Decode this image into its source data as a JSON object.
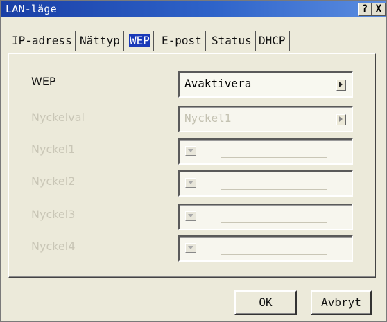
{
  "window": {
    "title": "LAN-läge",
    "help_label": "?",
    "close_label": "X"
  },
  "tabs": [
    {
      "label": "IP-adress",
      "active": false
    },
    {
      "label": "Nättyp",
      "active": false
    },
    {
      "label": "WEP",
      "active": true
    },
    {
      "label": "E-post",
      "active": false
    },
    {
      "label": "Status",
      "active": false
    },
    {
      "label": "DHCP",
      "active": false
    }
  ],
  "rows": {
    "wep": {
      "label": "WEP",
      "value": "Avaktivera",
      "enabled": true
    },
    "key_select": {
      "label": "Nyckelval",
      "value": "Nyckel1",
      "enabled": false
    },
    "key1": {
      "label": "Nyckel1",
      "value": "",
      "enabled": false
    },
    "key2": {
      "label": "Nyckel2",
      "value": "",
      "enabled": false
    },
    "key3": {
      "label": "Nyckel3",
      "value": "",
      "enabled": false
    },
    "key4": {
      "label": "Nyckel4",
      "value": "",
      "enabled": false
    }
  },
  "buttons": {
    "ok": "OK",
    "cancel": "Avbryt"
  },
  "icons": {
    "right_arrow": "right-arrow-icon",
    "dropdown": "dropdown-icon"
  },
  "colors": {
    "title_bar": "#1a3fa6",
    "active_tab": "#1a3ab8",
    "disabled_text": "#c9c6b6"
  }
}
